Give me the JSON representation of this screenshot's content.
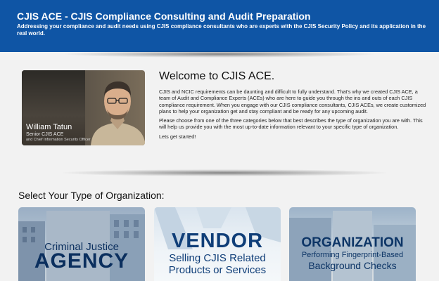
{
  "header": {
    "title": "CJIS ACE - CJIS Compliance Consulting and Audit Preparation",
    "subtitle": "Addressing your compliance and audit needs using CJIS compliance consultants who are experts with the CJIS Security Policy and its application in the real world."
  },
  "profile": {
    "name": "William Tatun",
    "role_line1": "Senior CJIS ACE",
    "role_line2": "and Chief Information Security Officer"
  },
  "welcome": {
    "title": "Welcome to CJIS ACE.",
    "paragraphs": [
      "CJIS and NCIC requirements can be daunting and difficult to fully understand. That's why we created CJIS ACE, a team of Audit and Compliance Experts (ACEs) who are here to guide you through the ins and outs of each CJIS compliance requirement. When you engage with our CJIS compliance consultants, CJIS ACEs, we create customized plans to help your organization get and stay compliant and be ready for any upcoming audit.",
      "Please choose from one of the three categories below that best describes the type of organization you are with. This will help us provide you with the most up-to-date information relevant to your specific type of organization.",
      "Lets get started!"
    ]
  },
  "section": {
    "title": "Select Your Type of Organization:"
  },
  "cards": {
    "agency": {
      "line1": "Criminal Justice",
      "line2": "AGENCY"
    },
    "vendor": {
      "line1": "VENDOR",
      "line2": "Selling CJIS Related",
      "line3": "Products or Services"
    },
    "organization": {
      "line1": "ORGANIZATION",
      "line2": "Performing Fingerprint-Based",
      "line3": "Background Checks"
    }
  },
  "colors": {
    "header_bg": "#0f55a5",
    "agency_text": "#0b2f5e",
    "vendor_text": "#0f3e78",
    "org_text": "#0d3566"
  }
}
